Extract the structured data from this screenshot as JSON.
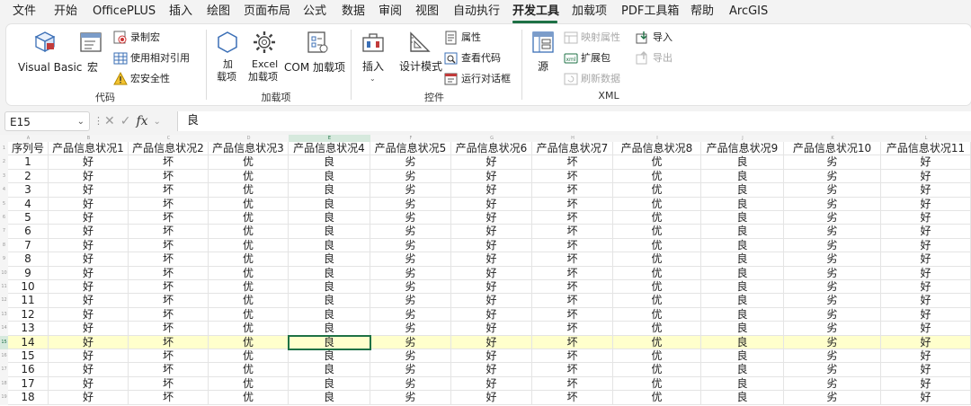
{
  "menu": {
    "tabs": [
      "文件",
      "开始",
      "OfficePLUS",
      "插入",
      "绘图",
      "页面布局",
      "公式",
      "数据",
      "审阅",
      "视图",
      "自动执行",
      "开发工具",
      "加载项",
      "PDF工具箱",
      "帮助",
      "ArcGIS"
    ],
    "active_tab": "开发工具"
  },
  "ribbon": {
    "code": {
      "visual_basic": "Visual Basic",
      "macro": "宏",
      "record_macro": "录制宏",
      "relative_ref": "使用相对引用",
      "macro_security": "宏安全性",
      "label": "代码"
    },
    "addins": {
      "addins_line1": "加",
      "addins_line2": "载项",
      "excel_addins_line1": "Excel",
      "excel_addins_line2": "加载项",
      "com_addins": "COM 加载项",
      "label": "加载项"
    },
    "controls": {
      "insert": "插入",
      "design_mode": "设计模式",
      "properties": "属性",
      "view_code": "查看代码",
      "run_dialog": "运行对话框",
      "label": "控件"
    },
    "xml": {
      "source": "源",
      "map_properties": "映射属性",
      "expansion_packs": "扩展包",
      "refresh_data": "刷新数据",
      "import": "导入",
      "export": "导出",
      "label": "XML"
    }
  },
  "formula_bar": {
    "name_box": "E15",
    "fx": "fx",
    "value": "良"
  },
  "sheet": {
    "column_letters": [
      "A",
      "B",
      "C",
      "D",
      "E",
      "F",
      "G",
      "H",
      "I",
      "J",
      "K",
      "L"
    ],
    "headers": [
      "序列号",
      "产品信息状况1",
      "产品信息状况2",
      "产品信息状况3",
      "产品信息状况4",
      "产品信息状况5",
      "产品信息状况6",
      "产品信息状况7",
      "产品信息状况8",
      "产品信息状况9",
      "产品信息状况10",
      "产品信息状况11"
    ],
    "row_pattern": [
      "好",
      "坏",
      "优",
      "良",
      "劣",
      "好",
      "坏",
      "优",
      "良",
      "劣",
      "好"
    ],
    "row_ids": [
      "1",
      "2",
      "3",
      "4",
      "5",
      "6",
      "7",
      "8",
      "9",
      "10",
      "11",
      "12",
      "13",
      "14",
      "15",
      "16",
      "17",
      "18"
    ],
    "row_numbers": [
      "1",
      "2",
      "3",
      "4",
      "5",
      "6",
      "7",
      "8",
      "9",
      "10",
      "11",
      "12",
      "13",
      "14",
      "15",
      "16",
      "17",
      "18",
      "19"
    ],
    "highlight_row": "14",
    "active_cell": "E15"
  }
}
